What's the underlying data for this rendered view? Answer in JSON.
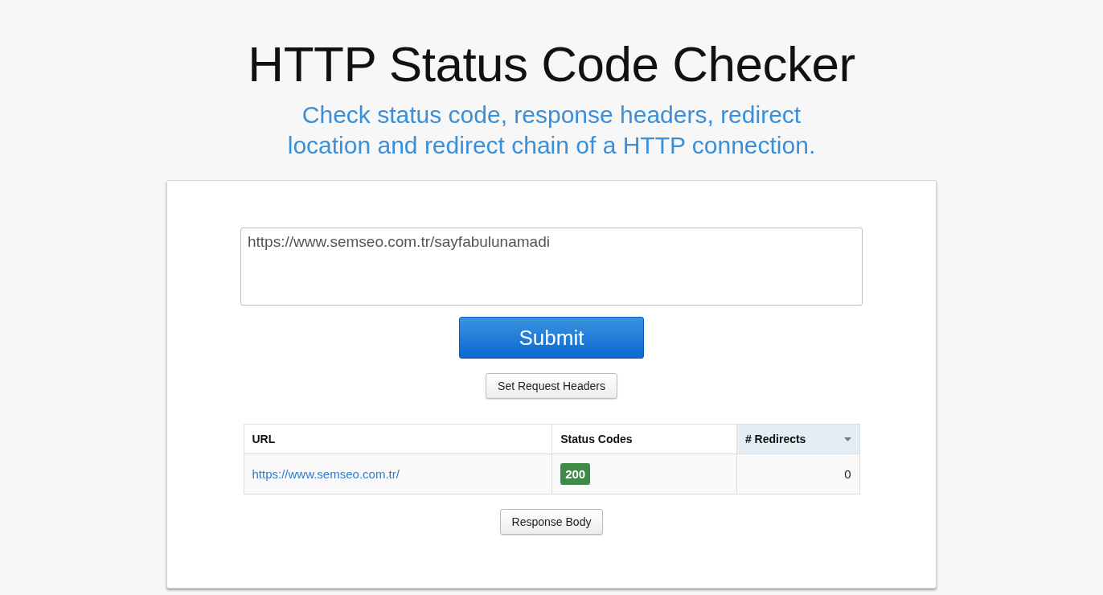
{
  "header": {
    "title": "HTTP Status Code Checker",
    "subtitle_lines": [
      "Check status code, response headers, redirect",
      "location and redirect chain of a HTTP connection."
    ]
  },
  "form": {
    "url_value": "https://www.semseo.com.tr/sayfabulunamadi",
    "submit_label": "Submit",
    "headers_button": "Set Request Headers"
  },
  "table": {
    "columns": [
      {
        "label": "URL",
        "sorted": false
      },
      {
        "label": "Status Codes",
        "sorted": false
      },
      {
        "label": "# Redirects",
        "sorted": true
      }
    ],
    "rows": [
      {
        "url": "https://www.semseo.com.tr/",
        "status": {
          "code": "200",
          "color": "#3f8a46"
        },
        "redirects": "0"
      }
    ]
  },
  "response_body_button": "Response Body"
}
